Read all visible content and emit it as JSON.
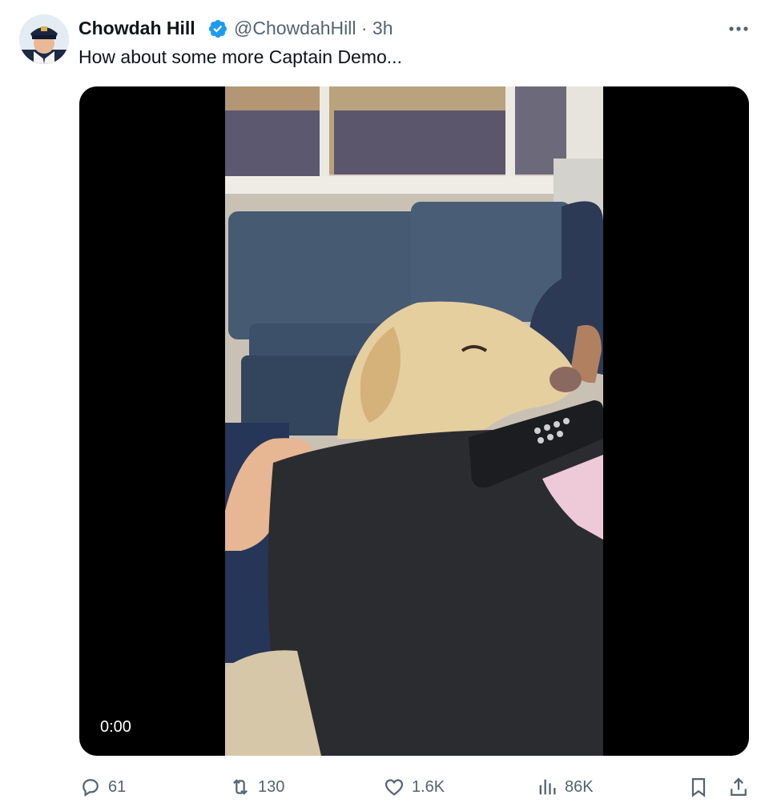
{
  "author": {
    "name": "Chowdah Hill",
    "handle": "@ChowdahHill",
    "separator": "·",
    "time": "3h"
  },
  "tweet": {
    "text": "How about some more Captain Demo..."
  },
  "media": {
    "timestamp": "0:00"
  },
  "actions": {
    "replies": "61",
    "reposts": "130",
    "likes": "1.6K",
    "views": "86K"
  },
  "colors": {
    "verified": "#1d9bf0",
    "secondary_text": "#536471",
    "primary_text": "#0f1419"
  }
}
